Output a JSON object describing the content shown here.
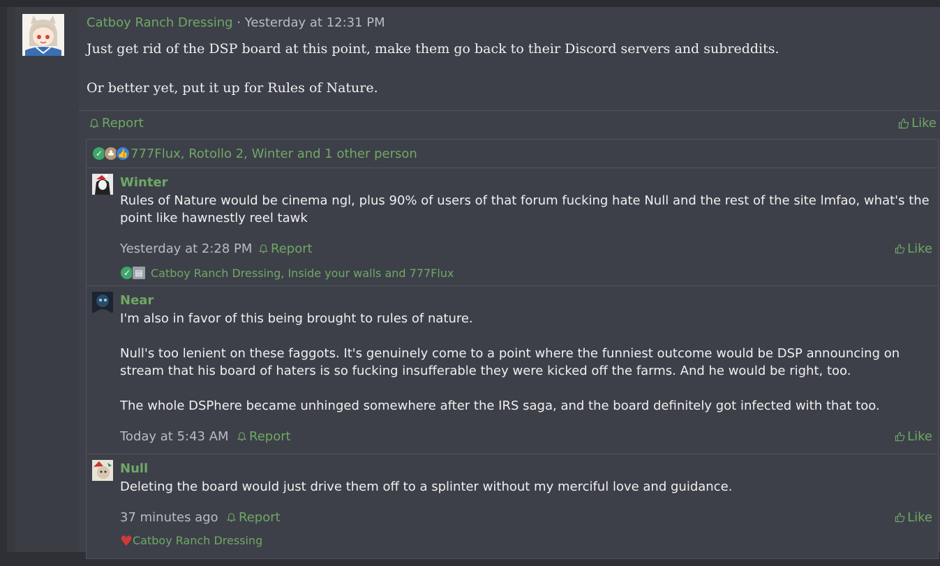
{
  "post": {
    "author": "Catboy Ranch Dressing",
    "separator": "·",
    "time": "Yesterday at 12:31 PM",
    "paragraphs": [
      "Just get rid of the DSP board at this point, make them go back to their Discord servers and subreddits.",
      "Or better yet, put it up for Rules of Nature."
    ],
    "report_label": "Report",
    "like_label": "Like",
    "reactions_text": "777Flux, Rotollo 2, Winter and 1 other person"
  },
  "comments": [
    {
      "author": "Winter",
      "paragraphs": [
        "Rules of Nature would be cinema ngl, plus 90% of users of that forum fucking hate Null and the rest of the site lmfao, what's the point like hawnestly reel tawk"
      ],
      "time": "Yesterday at 2:28 PM",
      "report_label": "Report",
      "like_label": "Like",
      "reactions_text": "Catboy Ranch Dressing, Inside your walls and 777Flux"
    },
    {
      "author": "Near",
      "paragraphs": [
        "I'm also in favor of this being brought to rules of nature.",
        "Null's too lenient on these faggots. It's genuinely come to a point where the funniest outcome would be DSP announcing on stream that his board of haters is so fucking insufferable they were kicked off the farms. And he would be right, too.",
        "The whole DSPhere became unhinged somewhere after the IRS saga, and the board definitely got infected with that too."
      ],
      "time": "Today at 5:43 AM",
      "report_label": "Report",
      "like_label": "Like"
    },
    {
      "author": "Null",
      "paragraphs": [
        "Deleting the board would just drive them off to a splinter without my merciful love and guidance."
      ],
      "time": "37 minutes ago",
      "report_label": "Report",
      "like_label": "Like",
      "reactions_text": "Catboy Ranch Dressing"
    }
  ],
  "colors": {
    "accent": "#6fa866",
    "background": "#3d4048",
    "muted_text": "#b8bcc3"
  },
  "icons": [
    "bell-icon",
    "thumbs-up-icon",
    "check-reaction-icon",
    "thumb-reaction-icon",
    "heart-reaction-icon"
  ]
}
